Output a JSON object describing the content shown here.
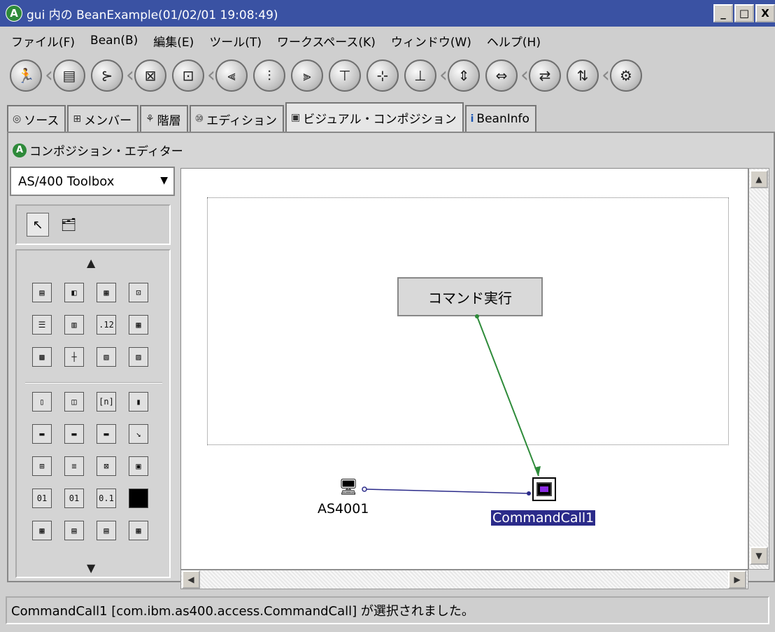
{
  "window": {
    "title": "gui 内の BeanExample(01/02/01 19:08:49)",
    "logo_letter": "A",
    "minimize": "_",
    "maximize": "□",
    "close": "X"
  },
  "menu": [
    "ファイル(F)",
    "Bean(B)",
    "編集(E)",
    "ツール(T)",
    "ワークスペース(K)",
    "ウィンドウ(W)",
    "ヘルプ(H)"
  ],
  "tabs": [
    {
      "label": "ソース",
      "icon": "◎"
    },
    {
      "label": "メンバー",
      "icon": "⊞"
    },
    {
      "label": "階層",
      "icon": "⚘"
    },
    {
      "label": "エディション",
      "icon": "⑩"
    },
    {
      "label": "ビジュアル・コンポジション",
      "icon": "▣"
    },
    {
      "label": "BeanInfo",
      "icon": "i"
    }
  ],
  "editor": {
    "title": "コンポジション・エディター",
    "logo_letter": "A"
  },
  "palette": {
    "category": "AS/400 Toolbox",
    "up_arrow": "▲",
    "down_arrow": "▼"
  },
  "canvas": {
    "button_label": "コマンド実行",
    "bean1_label": "AS4001",
    "bean2_label": "CommandCall1"
  },
  "status": {
    "message": "CommandCall1 [com.ibm.as400.access.CommandCall] が選択されました。"
  },
  "colors": {
    "title_bar": "#3a52a3",
    "connection_green": "#2e8b3a",
    "connection_blue": "#2b2b8a",
    "selection": "#2b2b8a"
  }
}
